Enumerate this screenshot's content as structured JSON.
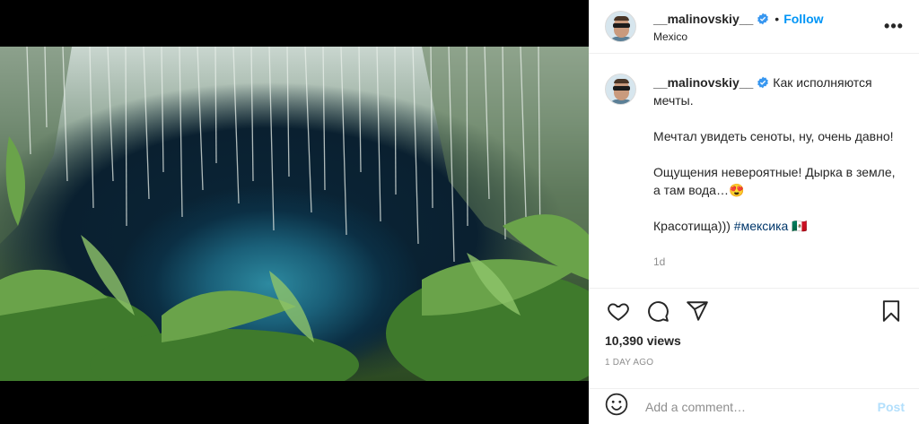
{
  "header": {
    "username": "__malinovskiy__",
    "separator": "•",
    "follow_label": "Follow",
    "location": "Mexico",
    "more_label": "•••"
  },
  "caption": {
    "username": "__malinovskiy__",
    "line1": "Как исполняются мечты.",
    "line2": "Мечтал увидеть сеноты, ну, очень давно!",
    "line3": "Ощущения невероятные! Дырка в земле, а там вода…😍",
    "line4_text": "Красотища))) ",
    "line4_hashtag": "#мексика",
    "line4_flag": " 🇲🇽",
    "time": "1d"
  },
  "stats": {
    "views": "10,390 views",
    "ago": "1 DAY AGO"
  },
  "comment": {
    "placeholder": "Add a comment…",
    "post_label": "Post"
  },
  "icons": {
    "verified": "verified-badge-icon",
    "like": "heart-icon",
    "comment": "comment-bubble-icon",
    "share": "paper-plane-icon",
    "save": "bookmark-icon",
    "emoji": "smiley-icon",
    "mute": "speaker-icon"
  },
  "colors": {
    "accent": "#0095f6",
    "verified": "#3897f0",
    "hashtag": "#00376b",
    "muted": "#8e8e8e",
    "post_disabled": "#b2dffc"
  }
}
